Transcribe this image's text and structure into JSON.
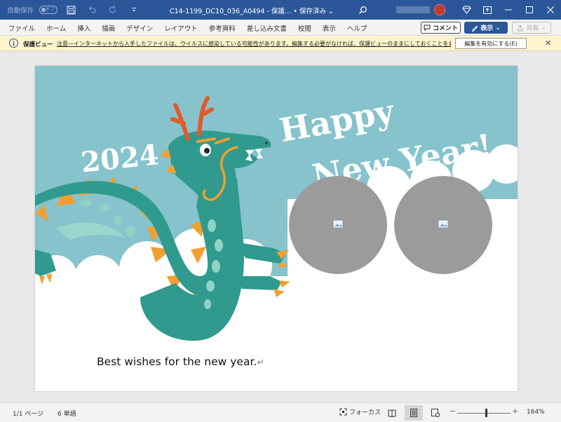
{
  "titlebar": {
    "autosave_label": "自動保存",
    "autosave_state": "オフ",
    "doc_title": "C14-1199_DC10_036_A0494 - 保護… • 保存済み ⌄",
    "colors": {
      "bar": "#2b579a"
    }
  },
  "ribbon": {
    "tabs": [
      "ファイル",
      "ホーム",
      "挿入",
      "描画",
      "デザイン",
      "レイアウト",
      "参考資料",
      "差し込み文書",
      "校閲",
      "表示",
      "ヘルプ"
    ],
    "comment_label": "コメント",
    "view_label": "表示",
    "share_label": "共有"
  },
  "protected_view": {
    "label": "保護ビュー",
    "message": "注意—インターネットから入手したファイルは、ウイルスに感染している可能性があります。編集する必要がなければ、保護ビューのままにしておくことをお勧めします。",
    "enable_button": "編集を有効にする(E)"
  },
  "document": {
    "year_text": "2024",
    "happy_text": "Happy",
    "new_year_text": "New Year!",
    "caption": "Best wishes for the new year.",
    "pilcrow": "↵",
    "colors": {
      "sky": "#86c3cc",
      "dragon": "#2f9a8d",
      "spikes": "#f0a030",
      "horns": "#e05a2b",
      "placeholder": "#9b9b9b"
    }
  },
  "statusbar": {
    "pages": "1/1 ページ",
    "words": "6 単語",
    "focus_label": "フォーカス",
    "zoom_value": "164%",
    "zoom_minus": "−",
    "zoom_plus": "+"
  }
}
